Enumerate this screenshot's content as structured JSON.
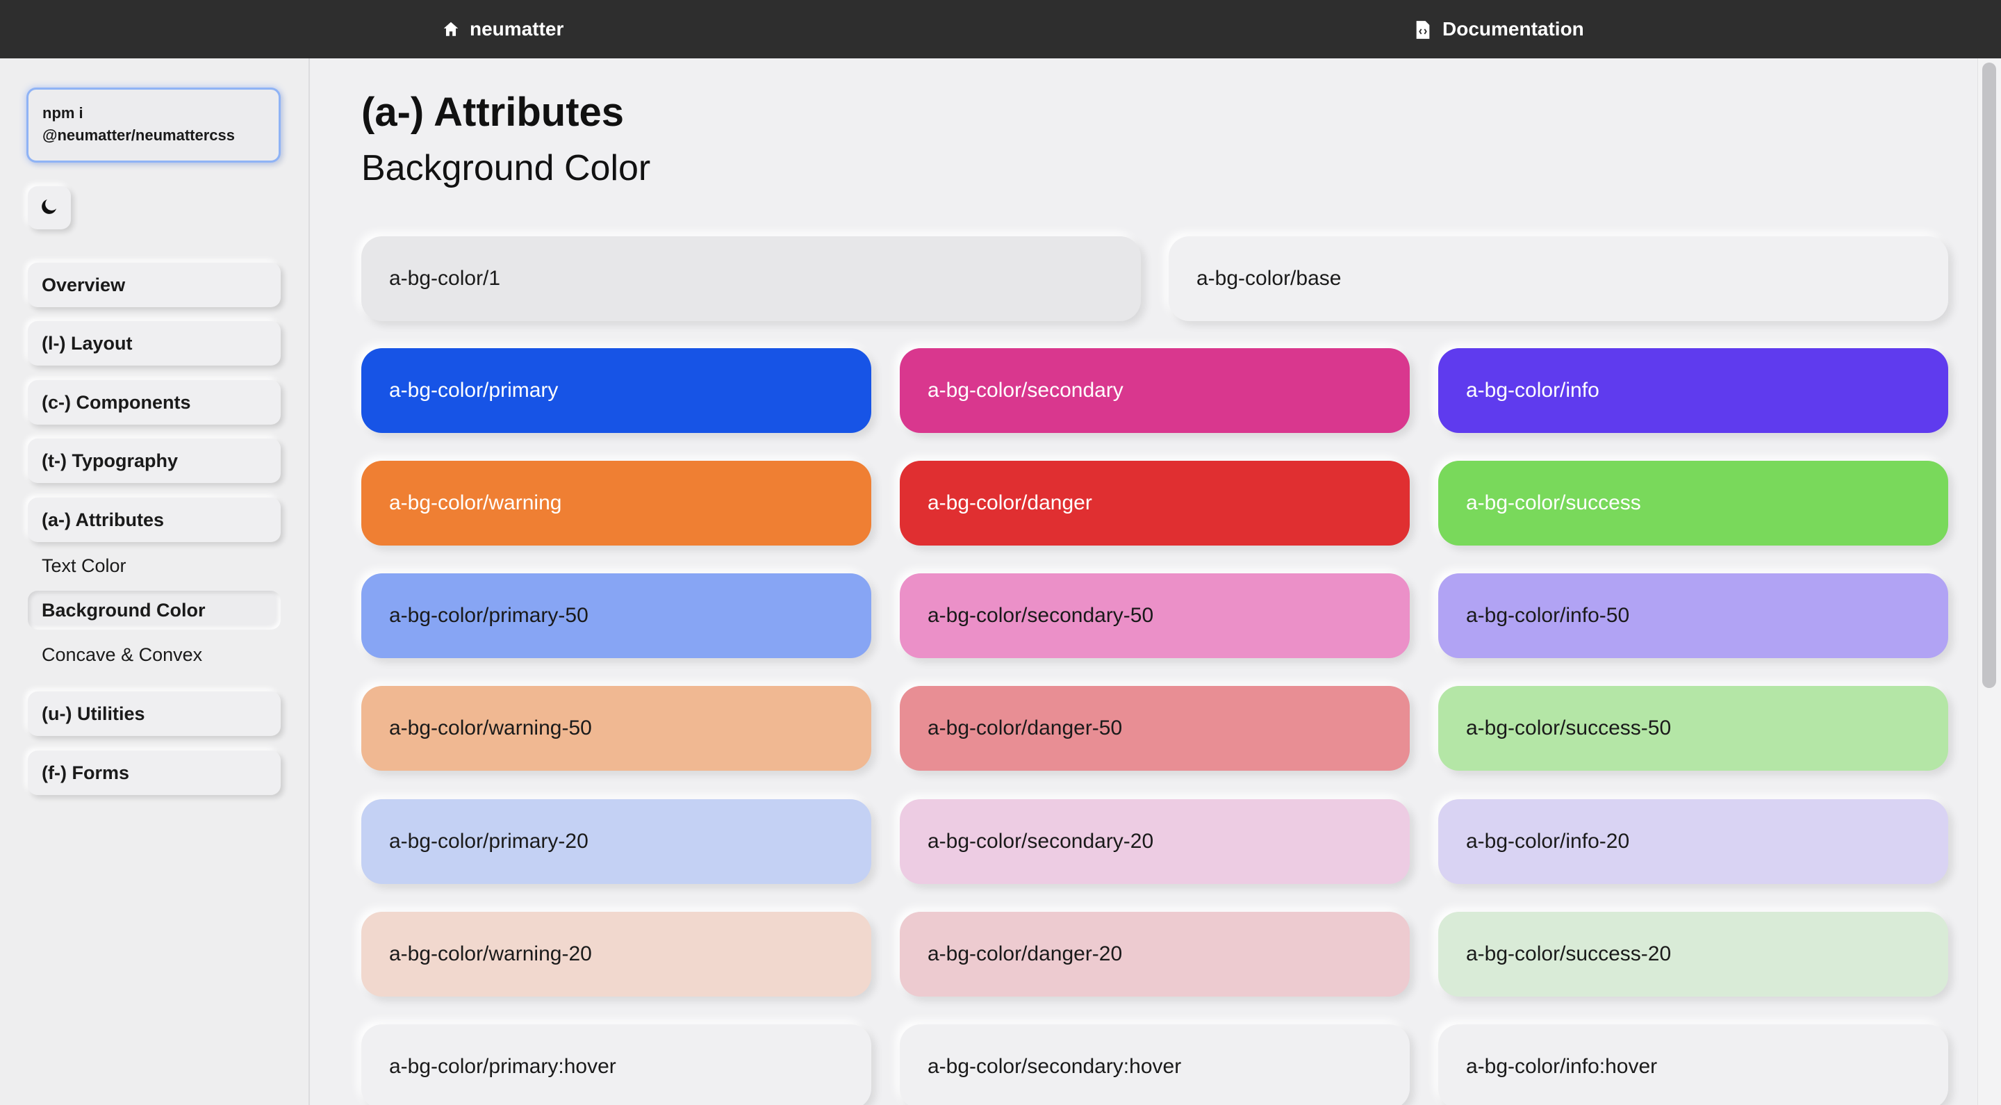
{
  "topbar": {
    "home_label": "neumatter",
    "docs_label": "Documentation"
  },
  "sidebar": {
    "install_command": "npm i\n@neumatter/neumattercss",
    "items": [
      {
        "label": "Overview"
      },
      {
        "label": "(l-) Layout"
      },
      {
        "label": "(c-) Components"
      },
      {
        "label": "(t-) Typography"
      },
      {
        "label": "(a-) Attributes"
      },
      {
        "label": "(u-) Utilities"
      },
      {
        "label": "(f-) Forms"
      }
    ],
    "sub_items": [
      {
        "label": "Text Color"
      },
      {
        "label": "Background Color"
      },
      {
        "label": "Concave & Convex"
      }
    ]
  },
  "main": {
    "title": "(a-) Attributes",
    "subtitle": "Background Color",
    "swatches": [
      {
        "label": "a-bg-color/1",
        "color": "#e7e7e9"
      },
      {
        "label": "a-bg-color/base",
        "color": "#f0f0f2"
      },
      {
        "label": "a-bg-color/primary",
        "color": "#1754e6"
      },
      {
        "label": "a-bg-color/secondary",
        "color": "#d9378e"
      },
      {
        "label": "a-bg-color/info",
        "color": "#5f3bee"
      },
      {
        "label": "a-bg-color/warning",
        "color": "#ef7f33"
      },
      {
        "label": "a-bg-color/danger",
        "color": "#e02f31"
      },
      {
        "label": "a-bg-color/success",
        "color": "#79d95b"
      },
      {
        "label": "a-bg-color/primary-50",
        "color": "#87a5f4"
      },
      {
        "label": "a-bg-color/secondary-50",
        "color": "#eb90c8"
      },
      {
        "label": "a-bg-color/info-50",
        "color": "#b1a3f4"
      },
      {
        "label": "a-bg-color/warning-50",
        "color": "#f0b892"
      },
      {
        "label": "a-bg-color/danger-50",
        "color": "#e88e94"
      },
      {
        "label": "a-bg-color/success-50",
        "color": "#b4e6a6"
      },
      {
        "label": "a-bg-color/primary-20",
        "color": "#c4d1f4"
      },
      {
        "label": "a-bg-color/secondary-20",
        "color": "#edcce3"
      },
      {
        "label": "a-bg-color/info-20",
        "color": "#d9d3f3"
      },
      {
        "label": "a-bg-color/warning-20",
        "color": "#f1d8ce"
      },
      {
        "label": "a-bg-color/danger-20",
        "color": "#edcbd0"
      },
      {
        "label": "a-bg-color/success-20",
        "color": "#d9ebd7"
      },
      {
        "label": "a-bg-color/primary:hover",
        "color": "#f0f0f2"
      },
      {
        "label": "a-bg-color/secondary:hover",
        "color": "#f0f0f2"
      },
      {
        "label": "a-bg-color/info:hover",
        "color": "#f0f0f2"
      }
    ]
  },
  "icons": {
    "home": "home-icon",
    "docs": "document-code-icon",
    "theme": "moon-icon"
  }
}
